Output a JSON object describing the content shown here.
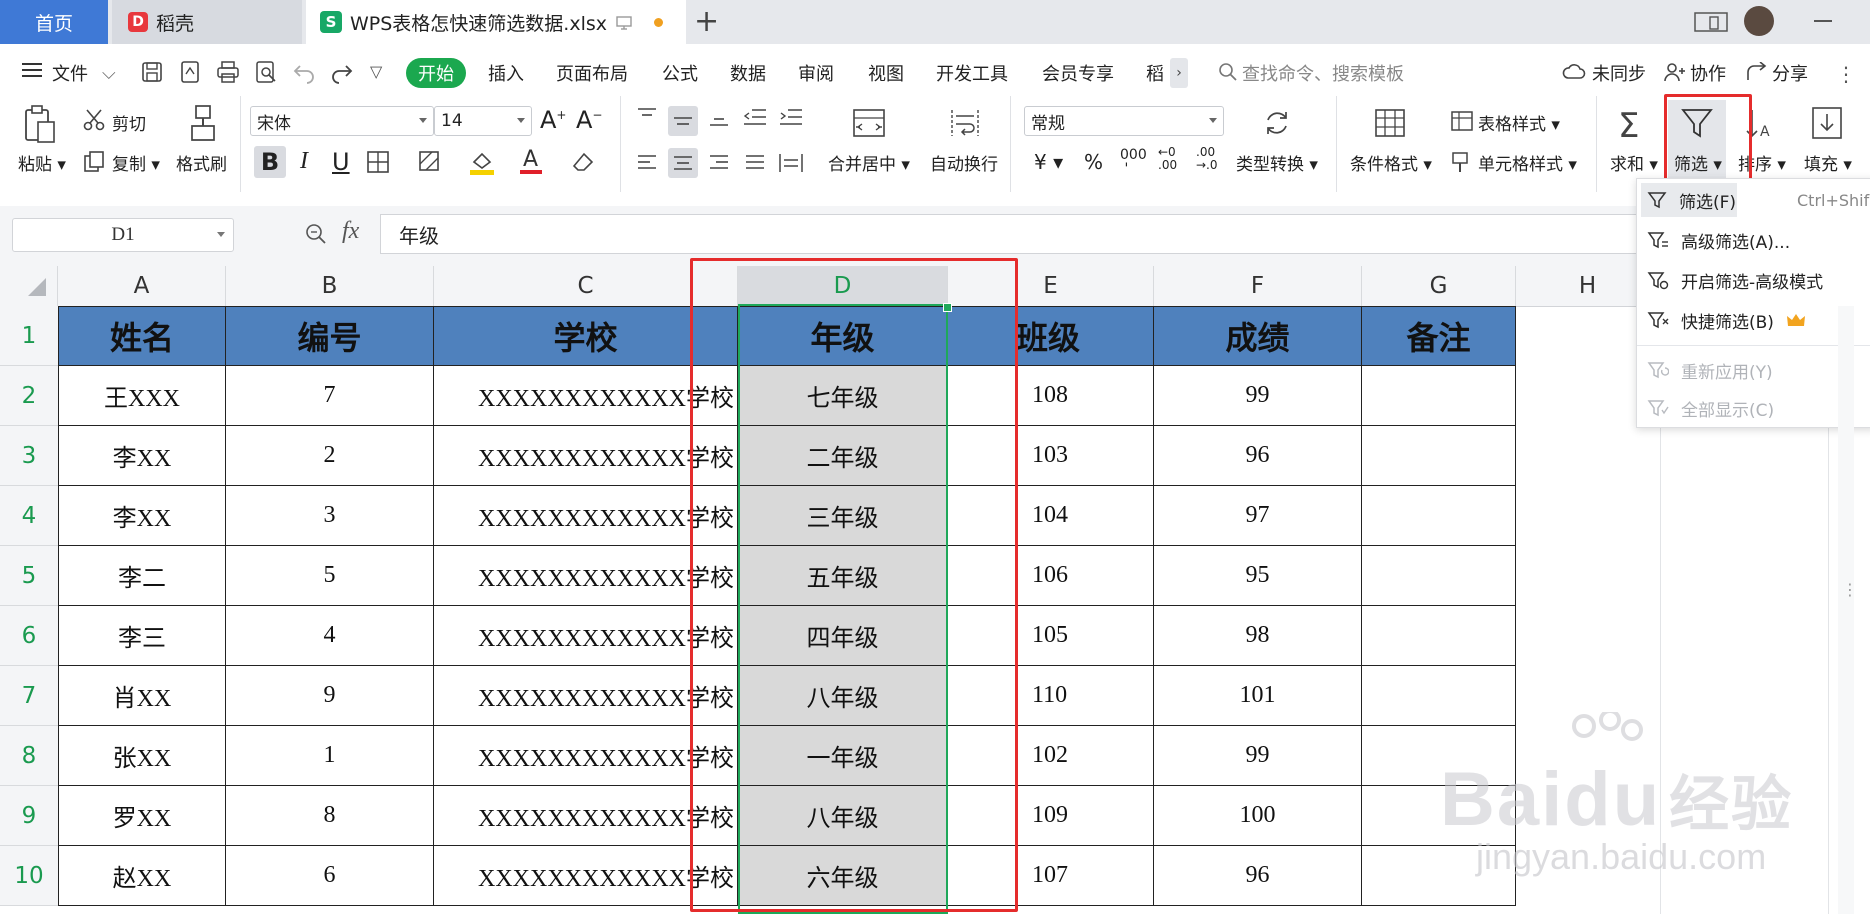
{
  "tabs": {
    "home": "首页",
    "daoke": "稻壳",
    "file": "WPS表格怎快速筛选数据.xlsx",
    "add": "+"
  },
  "menu": {
    "file": "文件",
    "items": [
      "开始",
      "插入",
      "页面布局",
      "公式",
      "数据",
      "审阅",
      "视图",
      "开发工具",
      "会员专享",
      "稻"
    ],
    "search_placeholder": "查找命令、搜索模板",
    "sync": "未同步",
    "collab": "协作",
    "share": "分享"
  },
  "ribbon": {
    "paste": "粘贴",
    "cut": "剪切",
    "copy": "复制",
    "format_painter": "格式刷",
    "font_name": "宋体",
    "font_size": "14",
    "merge_center": "合并居中",
    "auto_wrap": "自动换行",
    "number_format": "常规",
    "type_convert": "类型转换",
    "cond_format": "条件格式",
    "table_style": "表格样式",
    "cell_style": "单元格样式",
    "sum": "求和",
    "filter": "筛选",
    "sort": "排序",
    "fill": "填充"
  },
  "formula_bar": {
    "cell_ref": "D1",
    "fx": "fx",
    "value": "年级"
  },
  "columns": [
    "A",
    "B",
    "C",
    "D",
    "E",
    "F",
    "G",
    "H"
  ],
  "rows": [
    "1",
    "2",
    "3",
    "4",
    "5",
    "6",
    "7",
    "8",
    "9",
    "10"
  ],
  "table": {
    "headers": [
      "姓名",
      "编号",
      "学校",
      "年级",
      "班级",
      "成绩",
      "备注"
    ],
    "data": [
      [
        "王XXX",
        "7",
        "XXXXXXXXXXXX学校",
        "七年级",
        "108",
        "99",
        ""
      ],
      [
        "李XX",
        "2",
        "XXXXXXXXXXXX学校",
        "二年级",
        "103",
        "96",
        ""
      ],
      [
        "李XX",
        "3",
        "XXXXXXXXXXXX学校",
        "三年级",
        "104",
        "97",
        ""
      ],
      [
        "李二",
        "5",
        "XXXXXXXXXXXX学校",
        "五年级",
        "106",
        "95",
        ""
      ],
      [
        "李三",
        "4",
        "XXXXXXXXXXXX学校",
        "四年级",
        "105",
        "98",
        ""
      ],
      [
        "肖XX",
        "9",
        "XXXXXXXXXXXX学校",
        "八年级",
        "110",
        "101",
        ""
      ],
      [
        "张XX",
        "1",
        "XXXXXXXXXXXX学校",
        "一年级",
        "102",
        "99",
        ""
      ],
      [
        "罗XX",
        "8",
        "XXXXXXXXXXXX学校",
        "八年级",
        "109",
        "100",
        ""
      ],
      [
        "赵XX",
        "6",
        "XXXXXXXXXXXX学校",
        "六年级",
        "107",
        "96",
        ""
      ]
    ]
  },
  "filter_menu": {
    "items": [
      {
        "label": "筛选(F)",
        "shortcut": "Ctrl+Shif",
        "enabled": true
      },
      {
        "label": "高级筛选(A)...",
        "enabled": true
      },
      {
        "label": "开启筛选-高级模式",
        "enabled": true
      },
      {
        "label": "快捷筛选(B)",
        "enabled": true
      },
      {
        "label": "重新应用(Y)",
        "enabled": false
      },
      {
        "label": "全部显示(C)",
        "enabled": false
      }
    ]
  },
  "watermark": {
    "brand_left": "Bai",
    "brand_mid": "du",
    "brand_cn": "经验",
    "url": "jingyan.baidu.com"
  },
  "colors": {
    "accent_green": "#1ba84f",
    "header_fill": "#4f81bd",
    "highlight_red": "#e52c2c",
    "selected_col": "#d9d9d9",
    "tab_blue": "#3f79d6"
  }
}
